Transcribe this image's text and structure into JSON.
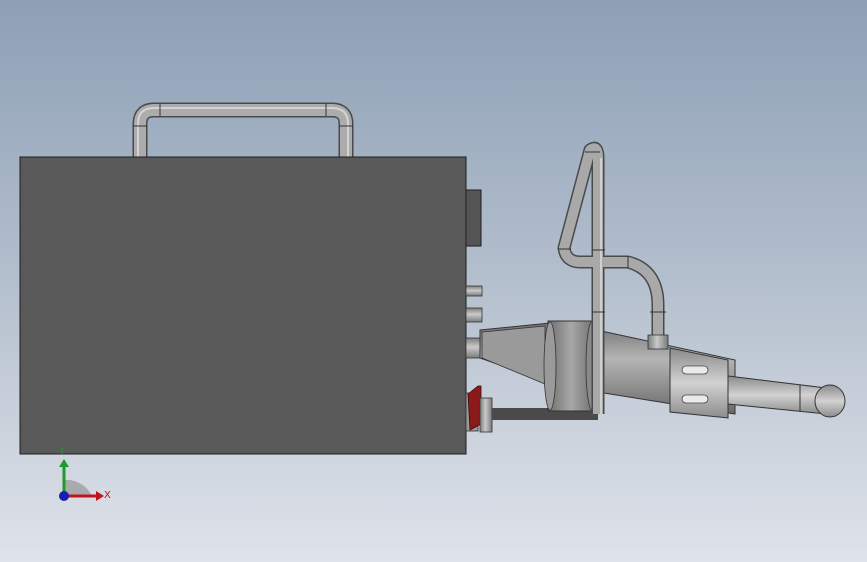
{
  "viewport": {
    "background_top": "#8da0b6",
    "background_bottom": "#dfe3ea"
  },
  "model": {
    "body_color": "#595959",
    "pipe_color": "#a9a9a9",
    "nozzle_color": "#9e9e9e",
    "valve_color": "#8b1a1a"
  },
  "triad": {
    "x_label": "X",
    "y_label": "Y",
    "x_color": "#c0141c",
    "y_color": "#1c9a2c",
    "z_color": "#1c1cb0"
  }
}
